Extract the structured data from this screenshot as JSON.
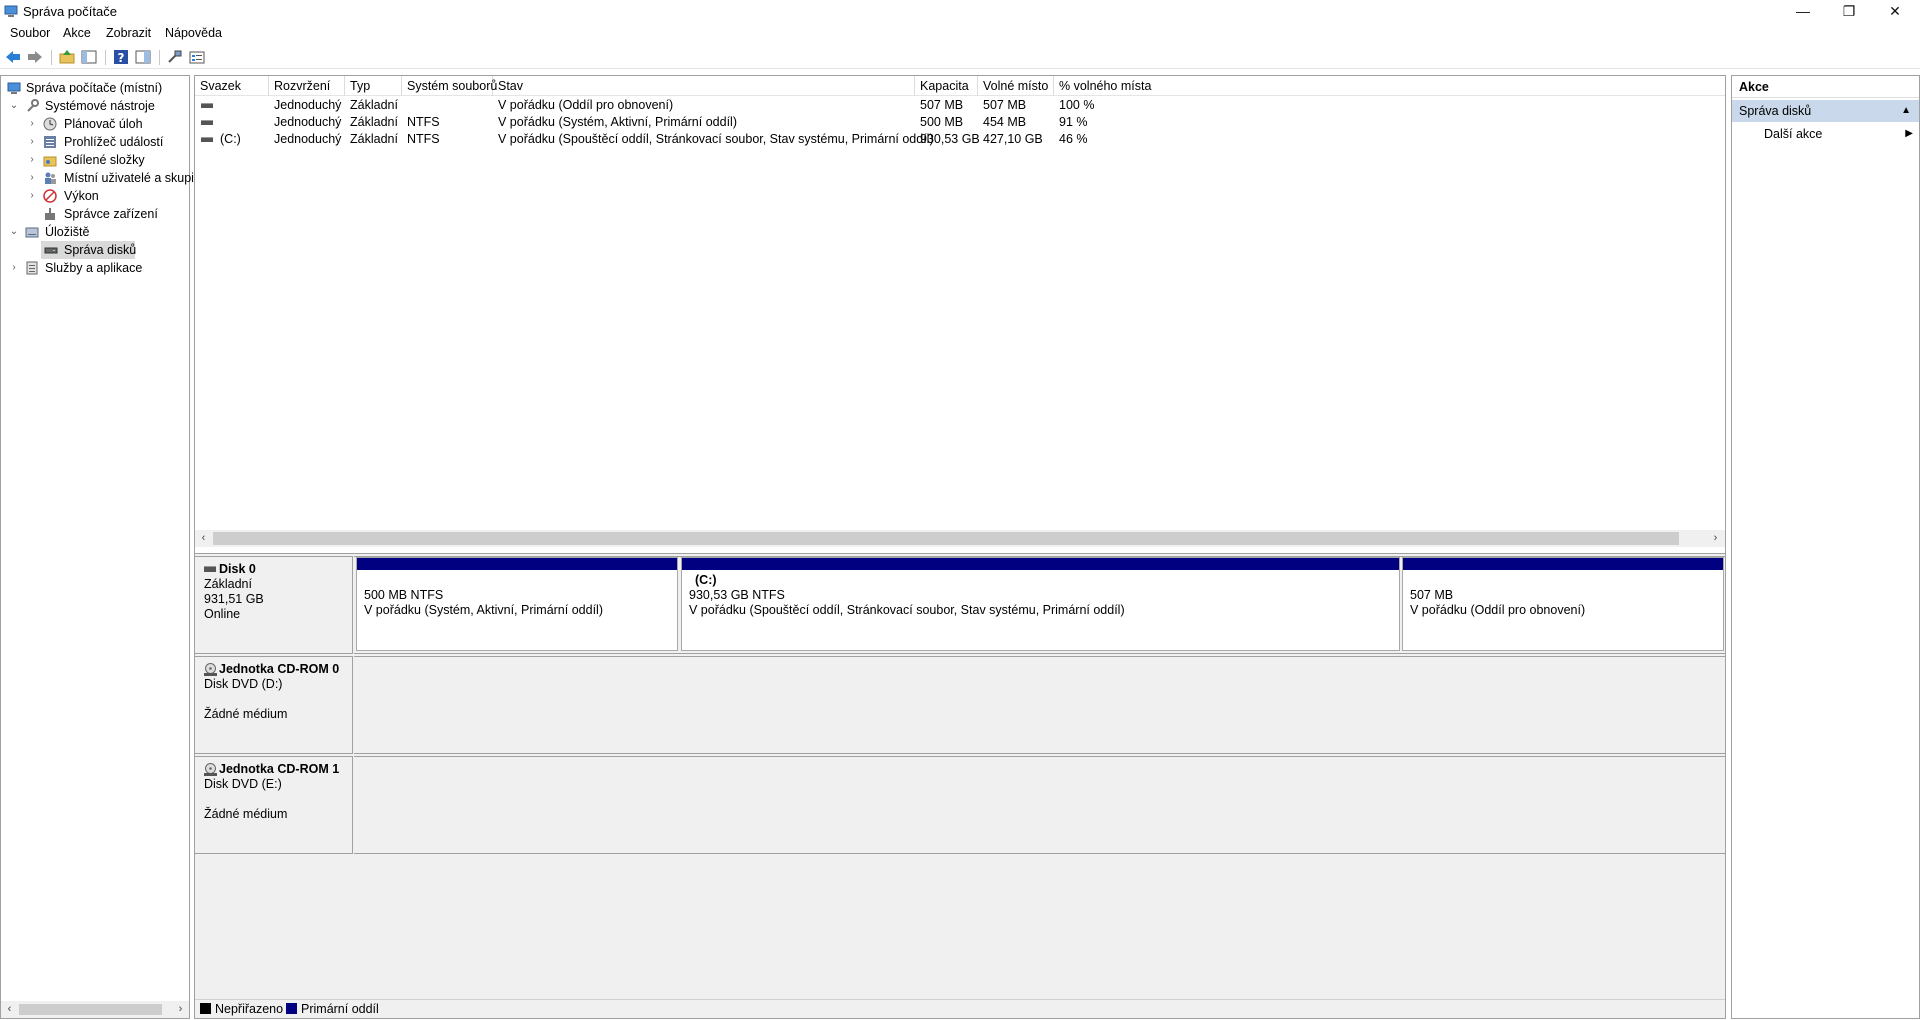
{
  "window": {
    "title": "Správa počítače",
    "controls": {
      "minimize": "—",
      "restore": "❐",
      "close": "✕"
    }
  },
  "menu": [
    "Soubor",
    "Akce",
    "Zobrazit",
    "Nápověda"
  ],
  "toolbar": {
    "icons": [
      "back-arrow-icon",
      "forward-arrow-icon",
      "up-folder-icon",
      "show-hide-tree-icon",
      "help-icon",
      "console-tree-icon",
      "connect-icon",
      "properties-icon"
    ],
    "colors": {
      "back_forward": "#2a7fd4",
      "help": "#2b4fa5"
    }
  },
  "tree": {
    "items": [
      {
        "label": "Správa počítače (místní)",
        "expander": "",
        "icon": "computer-management-icon"
      },
      {
        "label": "Systémové nástroje",
        "expander": "⌄",
        "icon": "tools-icon"
      },
      {
        "label": "Plánovač úloh",
        "expander": "›",
        "icon": "clock-icon"
      },
      {
        "label": "Prohlížeč událostí",
        "expander": "›",
        "icon": "event-viewer-icon"
      },
      {
        "label": "Sdílené složky",
        "expander": "›",
        "icon": "shared-folder-icon"
      },
      {
        "label": "Místní uživatelé a skupiny",
        "expander": "›",
        "icon": "users-icon"
      },
      {
        "label": "Výkon",
        "expander": "›",
        "icon": "performance-icon"
      },
      {
        "label": "Správce zařízení",
        "expander": "",
        "icon": "device-manager-icon"
      },
      {
        "label": "Úložiště",
        "expander": "⌄",
        "icon": "storage-icon"
      },
      {
        "label": "Správa disků",
        "expander": "",
        "icon": "disk-management-icon"
      },
      {
        "label": "Služby a aplikace",
        "expander": "›",
        "icon": "services-icon"
      }
    ],
    "scroll_left": "‹",
    "scroll_right": "›"
  },
  "volumes": {
    "columns": [
      "Svazek",
      "Rozvržení",
      "Typ",
      "Systém souborů",
      "Stav",
      "Kapacita",
      "Volné místo",
      "% volného místa"
    ],
    "rows": [
      [
        "",
        "Jednoduchý",
        "Základní",
        "",
        "V pořádku (Oddíl pro obnovení)",
        "507 MB",
        "507 MB",
        "100 %"
      ],
      [
        "",
        "Jednoduchý",
        "Základní",
        "NTFS",
        "V pořádku (Systém, Aktivní, Primární oddíl)",
        "500 MB",
        "454 MB",
        "91 %"
      ],
      [
        "(C:)",
        "Jednoduchý",
        "Základní",
        "NTFS",
        "V pořádku (Spouštěcí oddíl, Stránkovací soubor, Stav systému, Primární oddíl)",
        "930,53 GB",
        "427,10 GB",
        "46 %"
      ]
    ],
    "scroll_left": "‹",
    "scroll_right": "›"
  },
  "disks": [
    {
      "name": "Disk 0",
      "type": "Základní",
      "size": "931,51 GB",
      "status": "Online",
      "partitions": [
        {
          "label": "",
          "size": "500 MB NTFS",
          "status": "V pořádku (Systém, Aktivní, Primární oddíl)"
        },
        {
          "label": "(C:)",
          "size": "930,53 GB NTFS",
          "status": "V pořádku (Spouštěcí oddíl, Stránkovací soubor, Stav systému, Primární oddíl)"
        },
        {
          "label": "",
          "size": "507 MB",
          "status": "V pořádku (Oddíl pro obnovení)"
        }
      ]
    },
    {
      "name": "Jednotka CD-ROM 0",
      "type": "Disk DVD (D:)",
      "status": "Žádné médium"
    },
    {
      "name": "Jednotka CD-ROM 1",
      "type": "Disk DVD (E:)",
      "status": "Žádné médium"
    }
  ],
  "legend": [
    {
      "label": "Nepřiřazeno",
      "color": "#000000"
    },
    {
      "label": "Primární oddíl",
      "color": "#000080"
    }
  ],
  "actions": {
    "title": "Akce",
    "section": "Správa disků",
    "section_arrow": "▲",
    "item": "Další akce",
    "item_arrow": "▶"
  }
}
